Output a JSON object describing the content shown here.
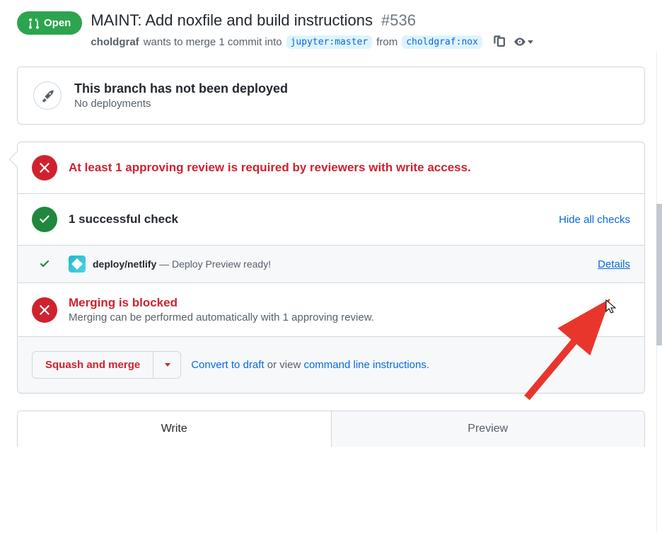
{
  "header": {
    "state": "Open",
    "title": "MAINT: Add noxfile and build instructions",
    "number": "#536",
    "author": "choldgraf",
    "wants": "wants to merge 1 commit into",
    "base": "jupyter:master",
    "from": "from",
    "head": "choldgraf:nox"
  },
  "deploy_box": {
    "title": "This branch has not been deployed",
    "subtitle": "No deployments"
  },
  "review_row": {
    "text": "At least 1 approving review is required by reviewers with write access."
  },
  "checks_row": {
    "title": "1 successful check",
    "hide": "Hide all checks"
  },
  "check_item": {
    "name": "deploy/netlify",
    "dash": " — ",
    "desc": "Deploy Preview ready!",
    "details": "Details"
  },
  "blocked_row": {
    "title": "Merging is blocked",
    "sub": "Merging can be performed automatically with 1 approving review."
  },
  "footer": {
    "squash": "Squash and merge",
    "convert": "Convert to draft",
    "mid": " or view ",
    "cli": "command line instructions",
    "period": "."
  },
  "tabs": {
    "write": "Write",
    "preview": "Preview"
  }
}
